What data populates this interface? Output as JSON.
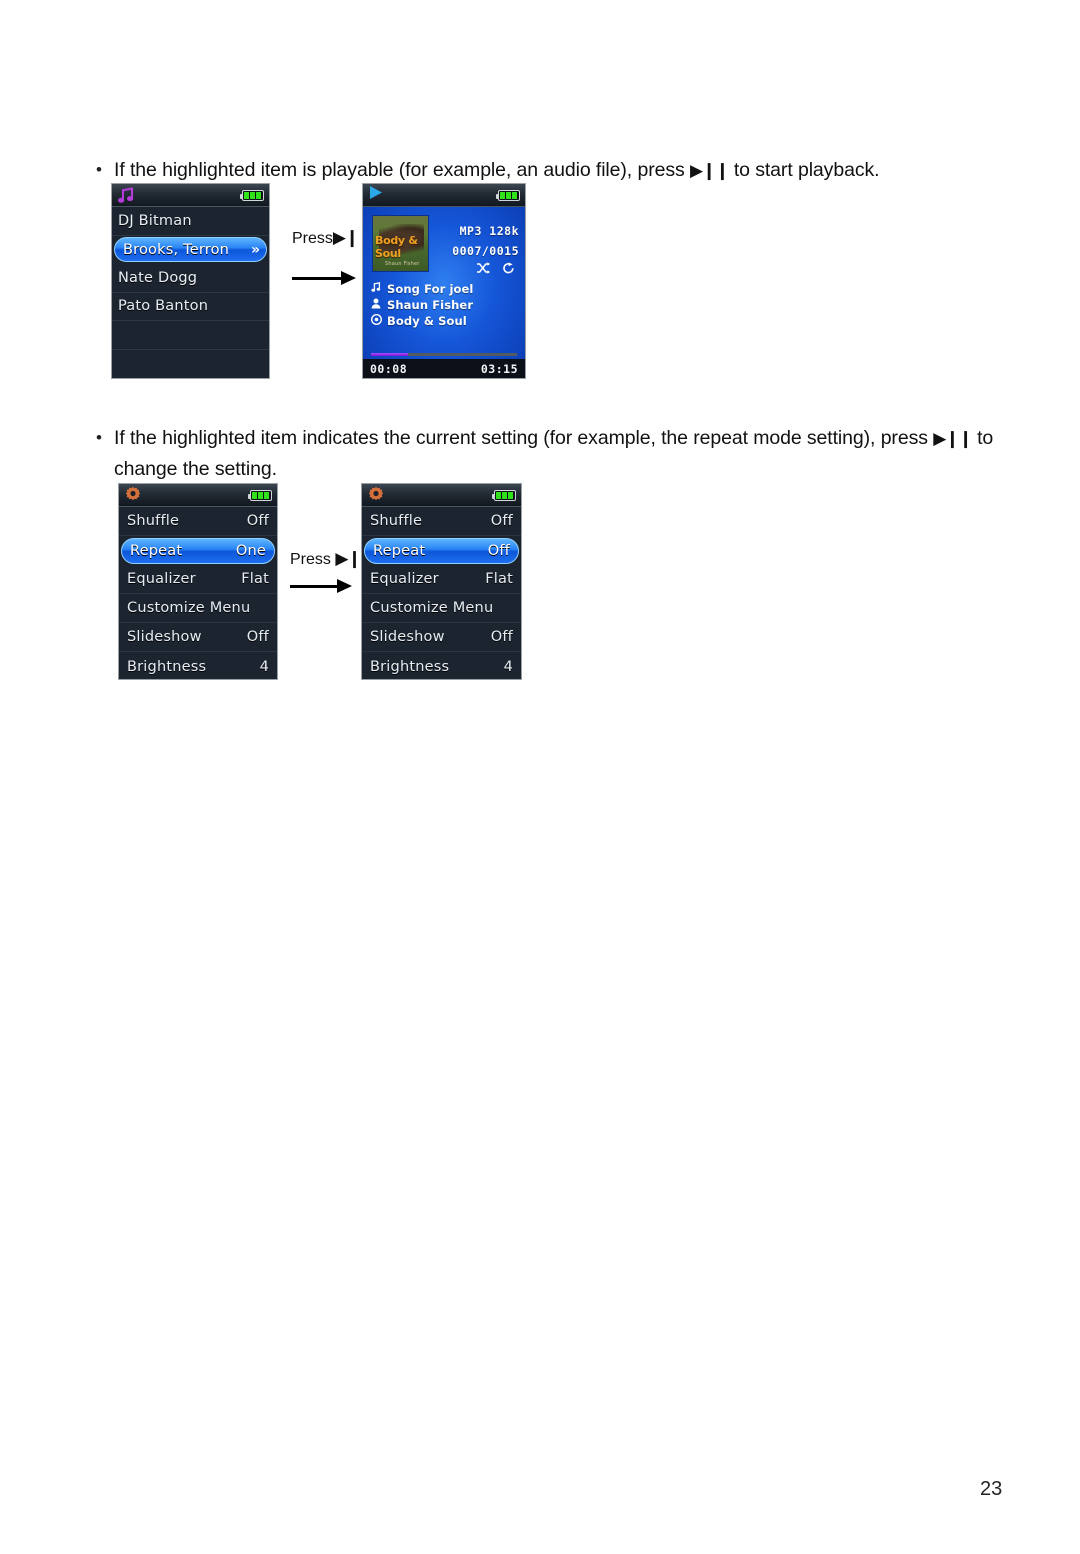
{
  "page": {
    "number": "23"
  },
  "bullets": [
    {
      "marker": "•",
      "text_before": "If the highlighted item is playable (for example, an audio file), press ",
      "glyph": "▶❙❙",
      "text_after": " to start playback."
    },
    {
      "marker": "•",
      "text_before": "If the highlighted item indicates the current setting (for example, the repeat mode setting), press ",
      "glyph": "▶❙❙",
      "text_after": " to",
      "line2": "change the setting."
    }
  ],
  "press_labels": {
    "row1": "Press",
    "row2": "Press",
    "glyph": "▶❙❙"
  },
  "browse_screen": {
    "status_icon": "music-note-icon",
    "battery": "full",
    "items": [
      {
        "label": "DJ Bitman",
        "selected": false,
        "chevron": ""
      },
      {
        "label": "Brooks, Terron",
        "selected": true,
        "chevron": "»"
      },
      {
        "label": "Nate Dogg",
        "selected": false,
        "chevron": ""
      },
      {
        "label": "Pato Banton",
        "selected": false,
        "chevron": ""
      },
      {
        "label": "",
        "selected": false,
        "chevron": ""
      },
      {
        "label": "",
        "selected": false,
        "chevron": ""
      }
    ]
  },
  "now_playing_screen": {
    "status_icon": "play-icon",
    "battery": "full",
    "album_art": {
      "title": "Body & Soul",
      "subtitle": "Shaun Fisher"
    },
    "format": "MP3  128k",
    "track_index": "0007/0015",
    "mode_icons": [
      "shuffle-icon",
      "repeat-icon"
    ],
    "shuffle_glyph": "⤨",
    "repeat_glyph": "↻",
    "meta": [
      {
        "icon": "music-note-icon",
        "glyph": "♪",
        "text": "Song For joel"
      },
      {
        "icon": "artist-icon",
        "glyph": "♟",
        "text": "Shaun Fisher"
      },
      {
        "icon": "album-icon",
        "glyph": "◎",
        "text": "Body & Soul"
      }
    ],
    "progress_percent": 25,
    "elapsed": "00:08",
    "duration": "03:15"
  },
  "settings_before": {
    "status_icon": "gear-icon",
    "battery": "full",
    "rows": [
      {
        "name": "Shuffle",
        "value": "Off",
        "selected": false
      },
      {
        "name": "Repeat",
        "value": "One",
        "selected": true
      },
      {
        "name": "Equalizer",
        "value": "Flat",
        "selected": false
      },
      {
        "name": "Customize Menu",
        "value": "",
        "selected": false
      },
      {
        "name": "Slideshow",
        "value": "Off",
        "selected": false
      },
      {
        "name": "Brightness",
        "value": "4",
        "selected": false
      }
    ]
  },
  "settings_after": {
    "status_icon": "gear-icon",
    "battery": "full",
    "rows": [
      {
        "name": "Shuffle",
        "value": "Off",
        "selected": false
      },
      {
        "name": "Repeat",
        "value": "Off",
        "selected": true
      },
      {
        "name": "Equalizer",
        "value": "Flat",
        "selected": false
      },
      {
        "name": "Customize Menu",
        "value": "",
        "selected": false
      },
      {
        "name": "Slideshow",
        "value": "Off",
        "selected": false
      },
      {
        "name": "Brightness",
        "value": "4",
        "selected": false
      }
    ]
  },
  "colors": {
    "highlight_blue": "#2a85f5",
    "screen_bg": "#1c2430",
    "now_playing_bg": "#1556d8",
    "battery_green": "#30e21a",
    "note_purple": "#b43cd8",
    "gear_orange": "#d4703a",
    "progress_purple": "#8a2be2"
  }
}
